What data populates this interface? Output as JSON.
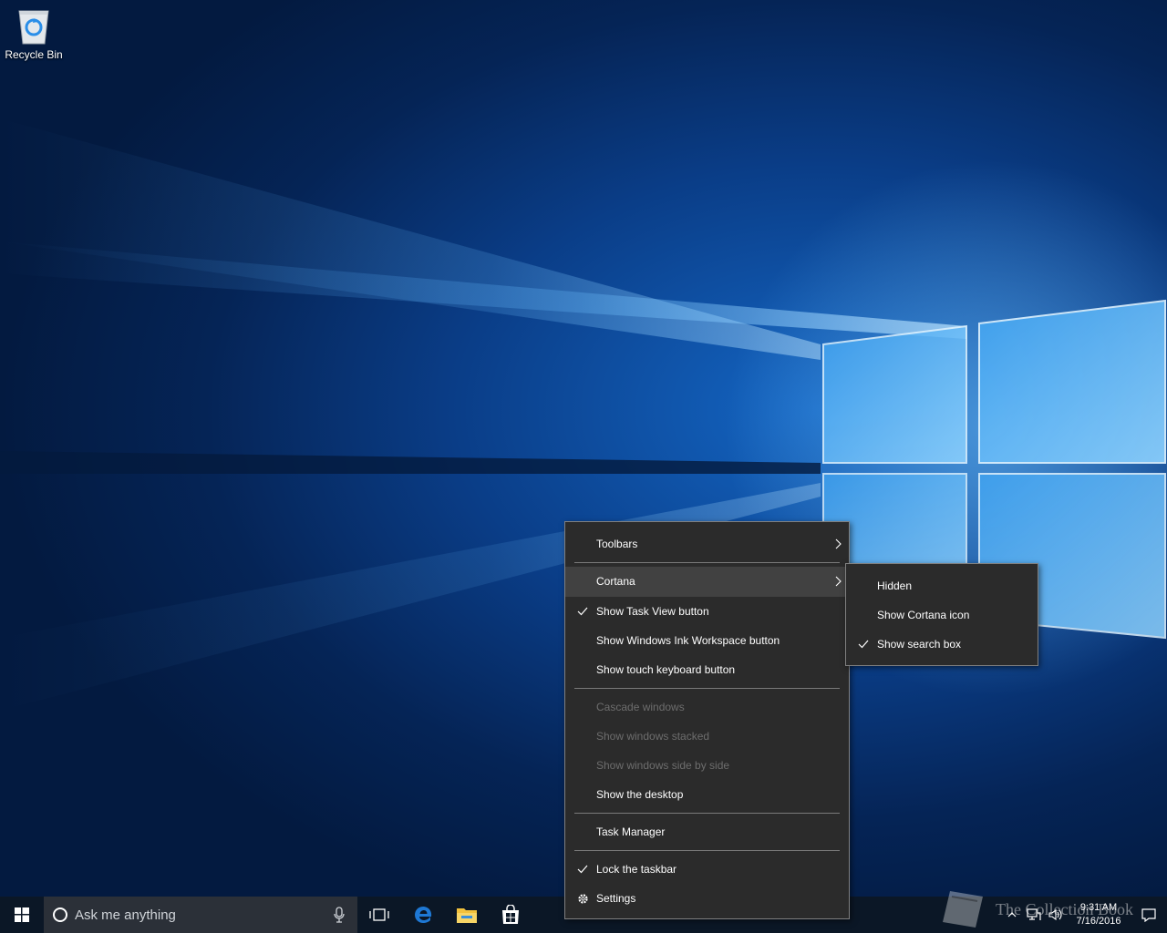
{
  "desktop": {
    "icons": [
      {
        "label": "Recycle Bin",
        "icon": "recycle-bin-icon"
      }
    ]
  },
  "taskbar": {
    "search_placeholder": "Ask me anything",
    "pinned": [
      {
        "name": "task-view-icon"
      },
      {
        "name": "edge-icon",
        "color": "#1e78d4"
      },
      {
        "name": "file-explorer-icon",
        "color": "#f2c13c"
      },
      {
        "name": "store-icon"
      }
    ],
    "clock": {
      "time": "9:31 AM",
      "date": "7/16/2016"
    }
  },
  "watermark": {
    "text": "The Collection Book"
  },
  "context_menu": {
    "items": [
      {
        "label": "Toolbars",
        "has_submenu": true
      },
      {
        "label": "Cortana",
        "has_submenu": true,
        "highlighted": true
      },
      {
        "label": "Show Task View button",
        "checked": true
      },
      {
        "label": "Show Windows Ink Workspace button"
      },
      {
        "label": "Show touch keyboard button"
      },
      {
        "label": "Cascade windows",
        "disabled": true
      },
      {
        "label": "Show windows stacked",
        "disabled": true
      },
      {
        "label": "Show windows side by side",
        "disabled": true
      },
      {
        "label": "Show the desktop"
      },
      {
        "label": "Task Manager"
      },
      {
        "label": "Lock the taskbar",
        "checked": true
      },
      {
        "label": "Settings",
        "icon": "gear-icon"
      }
    ]
  },
  "cortana_submenu": {
    "items": [
      {
        "label": "Hidden"
      },
      {
        "label": "Show Cortana icon"
      },
      {
        "label": "Show search box",
        "checked": true
      }
    ]
  },
  "colors": {
    "menu_bg": "#2b2b2b",
    "menu_highlight": "#414141",
    "menu_disabled_text": "#6d6d6d",
    "taskbar_bg": "#0b1726",
    "search_bg": "#2b3038"
  }
}
